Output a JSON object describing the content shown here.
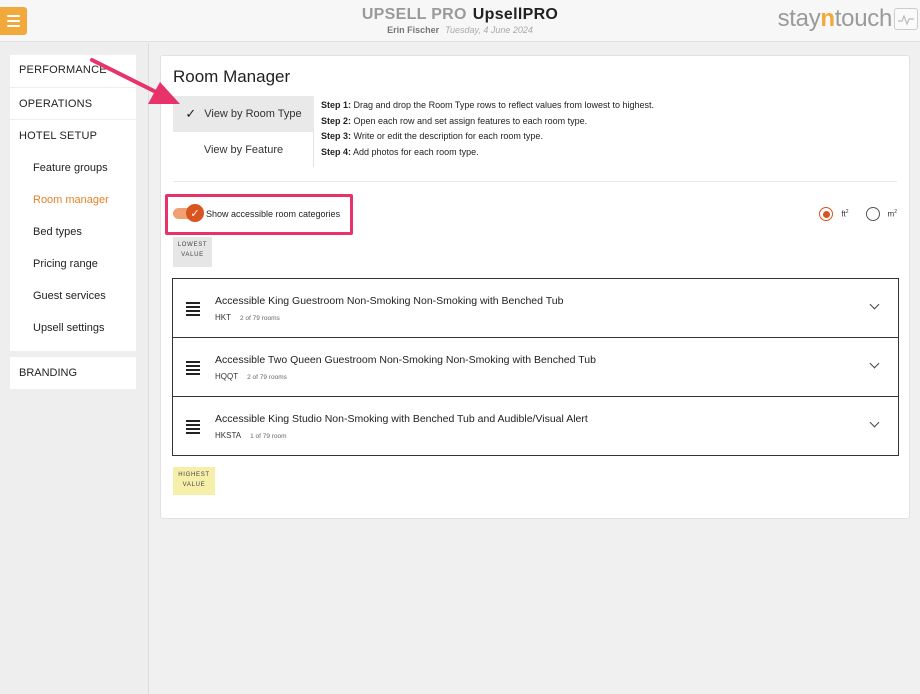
{
  "header": {
    "brand_part1": "UPSELL PRO",
    "brand_part2": "UpsellPRO",
    "user": "Erin Fischer",
    "date": "Tuesday, 4 June 2024",
    "logo_part1": "stay",
    "logo_part2": "n",
    "logo_part3": "touch"
  },
  "sidebar": {
    "performance": "PERFORMANCE",
    "operations": "OPERATIONS",
    "hotel_setup": "HOTEL SETUP",
    "items": [
      "Feature groups",
      "Room manager",
      "Bed types",
      "Pricing range",
      "Guest services",
      "Upsell settings"
    ],
    "active_item": "Room manager",
    "branding": "BRANDING"
  },
  "main": {
    "title": "Room Manager",
    "view_by_room_type": "View by Room Type",
    "view_by_feature": "View by Feature",
    "steps": [
      {
        "label": "Step 1:",
        "text": " Drag and drop the Room Type rows to reflect values from lowest to highest."
      },
      {
        "label": "Step 2:",
        "text": " Open each row and set assign features to each room type."
      },
      {
        "label": "Step 3:",
        "text": " Write or edit the description for each room type."
      },
      {
        "label": "Step 4:",
        "text": " Add photos for each room type."
      }
    ],
    "toggle_label": "Show accessible room categories",
    "toggle_on": true,
    "unit_ft": "ft",
    "unit_m": "m",
    "unit_sup": "2",
    "selected_unit": "ft2",
    "lowest_line1": "LOWEST",
    "lowest_line2": "VALUE",
    "highest_line1": "HIGHEST",
    "highest_line2": "VALUE",
    "rooms": [
      {
        "name": "Accessible King Guestroom Non-Smoking Non-Smoking with Benched Tub",
        "code": "HKT",
        "count": "2 of 79 rooms"
      },
      {
        "name": "Accessible Two Queen Guestroom Non-Smoking Non-Smoking with Benched Tub",
        "code": "HQQT",
        "count": "2 of 79 rooms"
      },
      {
        "name": "Accessible King Studio Non-Smoking with Benched Tub and Audible/Visual Alert",
        "code": "HKSTA",
        "count": "1 of 79 room"
      }
    ]
  },
  "colors": {
    "accent_orange": "#e8822a",
    "toggle_active": "#d9541e",
    "annotation_pink": "#e8336a",
    "highest_tag": "#f6efa9"
  }
}
